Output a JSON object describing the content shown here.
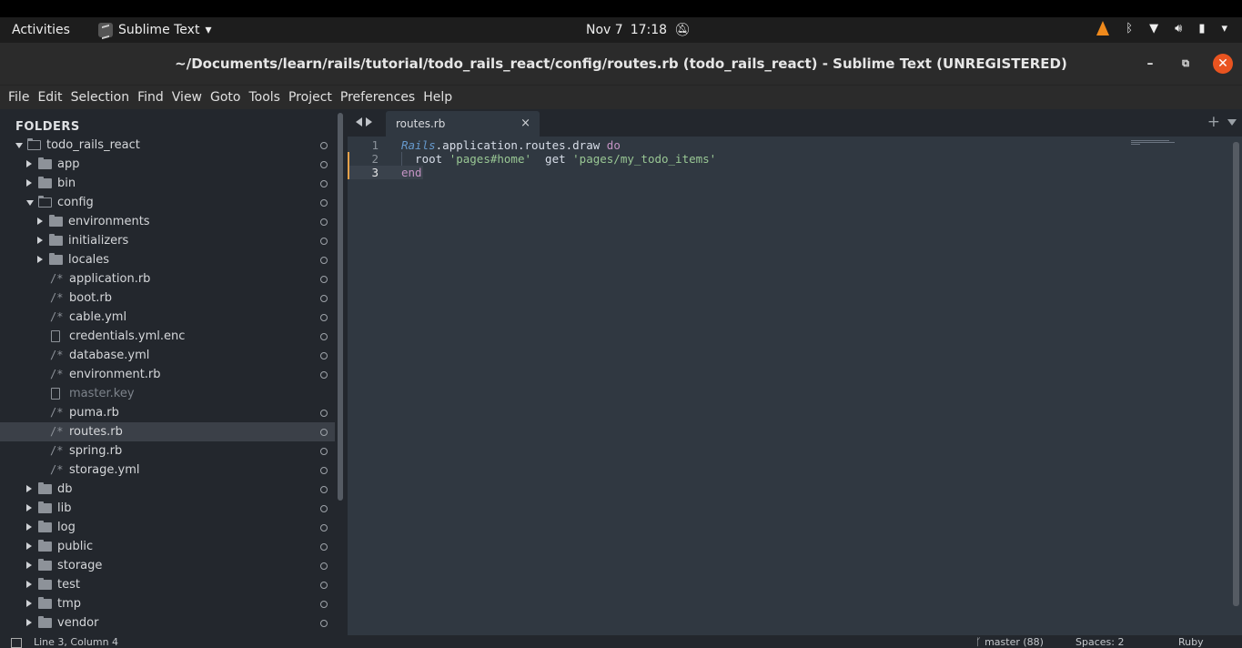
{
  "topbar": {
    "activities": "Activities",
    "app_name": "Sublime Text",
    "app_dropdown": "▾",
    "date": "Nov 7",
    "time": "17:18"
  },
  "window": {
    "title": "~/Documents/learn/rails/tutorial/todo_rails_react/config/routes.rb (todo_rails_react) - Sublime Text (UNREGISTERED)",
    "min_glyph": "–",
    "max_glyph": "⧉",
    "close_glyph": "✕"
  },
  "menu": [
    "File",
    "Edit",
    "Selection",
    "Find",
    "View",
    "Goto",
    "Tools",
    "Project",
    "Preferences",
    "Help"
  ],
  "sidebar": {
    "header": "FOLDERS",
    "tree": [
      {
        "label": "todo_rails_react",
        "type": "folder",
        "open": true,
        "depth": 0
      },
      {
        "label": "app",
        "type": "folder",
        "open": false,
        "depth": 1
      },
      {
        "label": "bin",
        "type": "folder",
        "open": false,
        "depth": 1
      },
      {
        "label": "config",
        "type": "folder",
        "open": true,
        "depth": 1
      },
      {
        "label": "environments",
        "type": "folder",
        "open": false,
        "depth": 2
      },
      {
        "label": "initializers",
        "type": "folder",
        "open": false,
        "depth": 2
      },
      {
        "label": "locales",
        "type": "folder",
        "open": false,
        "depth": 2
      },
      {
        "label": "application.rb",
        "type": "code",
        "depth": 2
      },
      {
        "label": "boot.rb",
        "type": "code",
        "depth": 2
      },
      {
        "label": "cable.yml",
        "type": "code",
        "depth": 2
      },
      {
        "label": "credentials.yml.enc",
        "type": "doc",
        "depth": 2
      },
      {
        "label": "database.yml",
        "type": "code",
        "depth": 2
      },
      {
        "label": "environment.rb",
        "type": "code",
        "depth": 2
      },
      {
        "label": "master.key",
        "type": "doc",
        "depth": 2,
        "dim": true
      },
      {
        "label": "puma.rb",
        "type": "code",
        "depth": 2
      },
      {
        "label": "routes.rb",
        "type": "code",
        "depth": 2,
        "selected": true
      },
      {
        "label": "spring.rb",
        "type": "code",
        "depth": 2
      },
      {
        "label": "storage.yml",
        "type": "code",
        "depth": 2
      },
      {
        "label": "db",
        "type": "folder",
        "open": false,
        "depth": 1
      },
      {
        "label": "lib",
        "type": "folder",
        "open": false,
        "depth": 1
      },
      {
        "label": "log",
        "type": "folder",
        "open": false,
        "depth": 1
      },
      {
        "label": "public",
        "type": "folder",
        "open": false,
        "depth": 1
      },
      {
        "label": "storage",
        "type": "folder",
        "open": false,
        "depth": 1
      },
      {
        "label": "test",
        "type": "folder",
        "open": false,
        "depth": 1
      },
      {
        "label": "tmp",
        "type": "folder",
        "open": false,
        "depth": 1
      },
      {
        "label": "vendor",
        "type": "folder",
        "open": false,
        "depth": 1
      }
    ],
    "code_glyph": "/*"
  },
  "tabs": [
    {
      "label": "routes.rb",
      "close": "×"
    }
  ],
  "tabbar": {
    "plus": "+"
  },
  "editor": {
    "line_numbers": [
      "1",
      "2",
      "3"
    ],
    "active_line": 3,
    "modified_lines": [
      2,
      3
    ],
    "lines": [
      [
        {
          "t": "Rails",
          "c": "cls"
        },
        {
          "t": ".application.routes.draw ",
          "c": "pln"
        },
        {
          "t": "do",
          "c": "kw"
        }
      ],
      [
        {
          "t": "  root ",
          "c": "pln"
        },
        {
          "t": "'pages#home'",
          "c": "str"
        },
        {
          "t": "  get ",
          "c": "pln"
        },
        {
          "t": "'pages/my_todo_items'",
          "c": "str"
        }
      ],
      [
        {
          "t": "end",
          "c": "kw"
        }
      ]
    ]
  },
  "status": {
    "position": "Line 3, Column 4",
    "git": "ᚴ master (88)",
    "spaces": "Spaces: 2",
    "syntax": "Ruby"
  },
  "colors": {
    "accent_close": "#e95420",
    "modified_marker": "#e5a14a",
    "string": "#99c794",
    "keyword": "#c594c5",
    "class": "#6699cc"
  }
}
